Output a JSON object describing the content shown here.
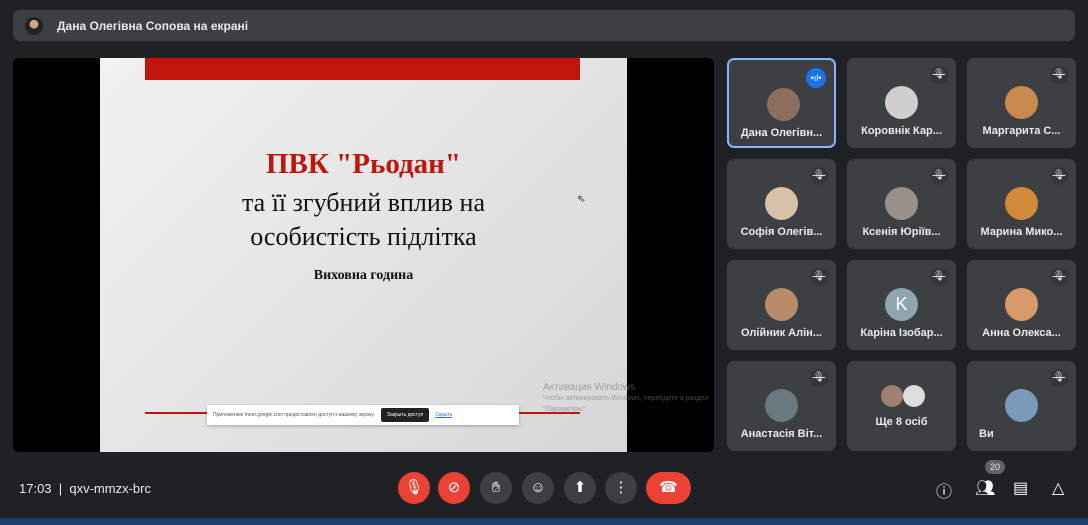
{
  "header": {
    "presenter_text": "Дана Олегівна Сопова на екрані"
  },
  "slide": {
    "title": "ПВК \"Рьодан\"",
    "subtitle_line1": "та її згубний вплив на",
    "subtitle_line2": "особистість підлітка",
    "caption": "Виховна година",
    "notification": {
      "text": "Приложению meet.google.com предоставлен доступ к вашему экрану.",
      "stop_button": "Закрыть доступ",
      "hide_link": "Скрыть"
    },
    "watermark": {
      "title": "Активация Windows",
      "text": "Чтобы активировать Windows, перейдите в раздел \"Параметры\"."
    }
  },
  "participants": [
    {
      "name": "Дана Олегівн...",
      "speaking": true,
      "color": "#8b6e5e"
    },
    {
      "name": "Коровнік Кар...",
      "color": "#cfcfcf"
    },
    {
      "name": "Маргарита С...",
      "color": "#c98a4e"
    },
    {
      "name": "Софія Олегів...",
      "color": "#d9c0a8"
    },
    {
      "name": "Ксенія Юріїв...",
      "color": "#9a8f8a"
    },
    {
      "name": "Марина Мико...",
      "color": "#d08a3a"
    },
    {
      "name": "Олійник Алін...",
      "color": "#b88c6a"
    },
    {
      "name": "Каріна Ізобар...",
      "initial": "K",
      "color": "#8fa6b0"
    },
    {
      "name": "Анна Олекса...",
      "color": "#d89a6a"
    },
    {
      "name": "Анастасія Віт...",
      "color": "#6a7a80"
    },
    {
      "name": "Ще 8 осіб",
      "color": "#a08070"
    },
    {
      "name": "Ви",
      "color": "#7a9ab8"
    }
  ],
  "bottom": {
    "time": "17:03",
    "meeting_code": "qxv-mmzx-brc",
    "participant_count": "20"
  }
}
